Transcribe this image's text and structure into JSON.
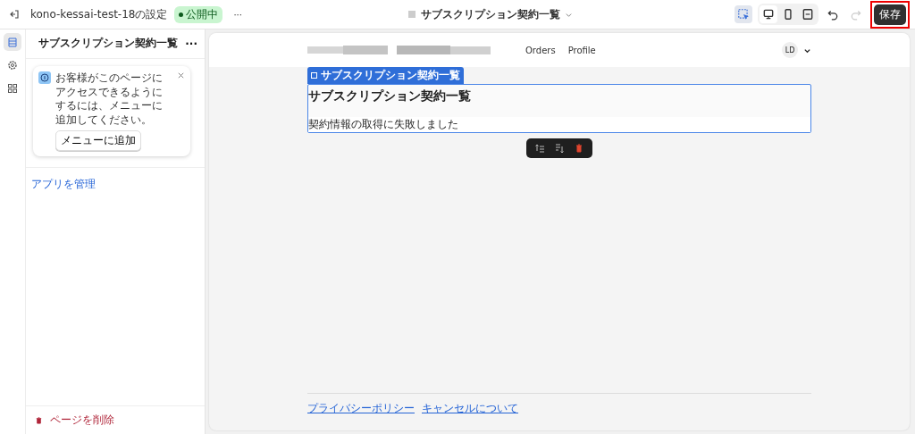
{
  "topbar": {
    "store": "kono-kessai-test-18の設定",
    "status": "公開中",
    "more": "···",
    "page_title": "サブスクリプション契約一覧",
    "tools": [
      {
        "kind": "inspector",
        "selected": true
      },
      {
        "kind": "desktop",
        "selected": true
      },
      {
        "kind": "mobile",
        "selected": false
      },
      {
        "kind": "fullwidth",
        "selected": false
      }
    ],
    "undo_disabled": false,
    "redo_disabled": true,
    "save": "保存"
  },
  "rail": [
    {
      "kind": "sections",
      "selected": true
    },
    {
      "kind": "settings",
      "selected": false
    },
    {
      "kind": "apps",
      "selected": false
    }
  ],
  "sidebar": {
    "title": "サブスクリプション契約一覧",
    "more": "···",
    "notice": {
      "text": "お客様がこのページにアクセスできるようにするには、メニューに追加してください。",
      "button": "メニューに追加"
    },
    "manage_link": "アプリを管理",
    "delete": "ページを削除"
  },
  "preview": {
    "nav": [
      "Orders",
      "Profile"
    ],
    "avatar": "LD",
    "block_tag": "サブスクリプション契約一覧",
    "heading": "サブスクリプション契約一覧",
    "error": "契約情報の取得に失敗しました",
    "footer_links": [
      "プライバシーポリシー",
      "キャンセルについて"
    ]
  }
}
